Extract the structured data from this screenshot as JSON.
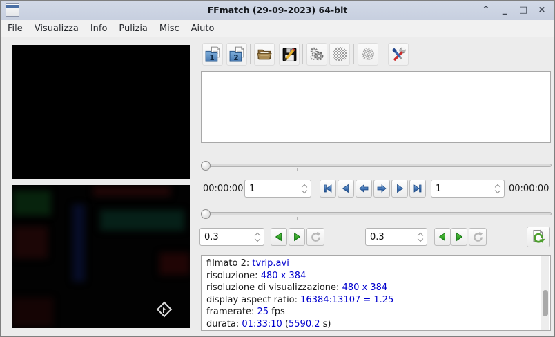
{
  "window": {
    "title": "FFmatch (29-09-2023) 64-bit",
    "shade_glyph": "^",
    "minimize_glyph": "_",
    "maximize_glyph": "□",
    "close_glyph": "×"
  },
  "menu": {
    "items": [
      "File",
      "Visualizza",
      "Info",
      "Pulizia",
      "Misc",
      "Aiuto"
    ]
  },
  "toolbar": {
    "icons": [
      "open-video-1",
      "open-video-2",
      "open-folder",
      "save-edit",
      "process-gears",
      "disabled-action-1",
      "disabled-action-2",
      "settings-tools"
    ],
    "folder1_number": "1",
    "folder2_number": "2"
  },
  "transport": {
    "time_left": "00:00:00",
    "time_right": "00:00:00",
    "frame_left": "1",
    "frame_right": "1",
    "step_left": "0.3",
    "step_right": "0.3",
    "slider1_position": 0,
    "slider2_position": 0
  },
  "info": {
    "lines": [
      [
        {
          "t": "filmato 2: ",
          "b": false
        },
        {
          "t": "tvrip.avi",
          "b": true
        }
      ],
      [
        {
          "t": "risoluzione: ",
          "b": false
        },
        {
          "t": "480 x 384",
          "b": true
        }
      ],
      [
        {
          "t": "risoluzione di visualizzazione: ",
          "b": false
        },
        {
          "t": "480 x 384",
          "b": true
        }
      ],
      [
        {
          "t": "display aspect ratio: ",
          "b": false
        },
        {
          "t": "16384:13107 = 1.25",
          "b": true
        }
      ],
      [
        {
          "t": "framerate: ",
          "b": false
        },
        {
          "t": "25",
          "b": true
        },
        {
          "t": " fps",
          "b": false
        }
      ],
      [
        {
          "t": "durata: ",
          "b": false
        },
        {
          "t": "01:33:10",
          "b": true
        },
        {
          "t": " (",
          "b": false
        },
        {
          "t": "5590.2",
          "b": true
        },
        {
          "t": " s)",
          "b": false
        }
      ]
    ]
  },
  "colors": {
    "titlebar": "#ccd3e2",
    "accent_blue": "#2e5f9f",
    "accent_green": "#1e9a1e",
    "link_blue": "#0000cd"
  }
}
